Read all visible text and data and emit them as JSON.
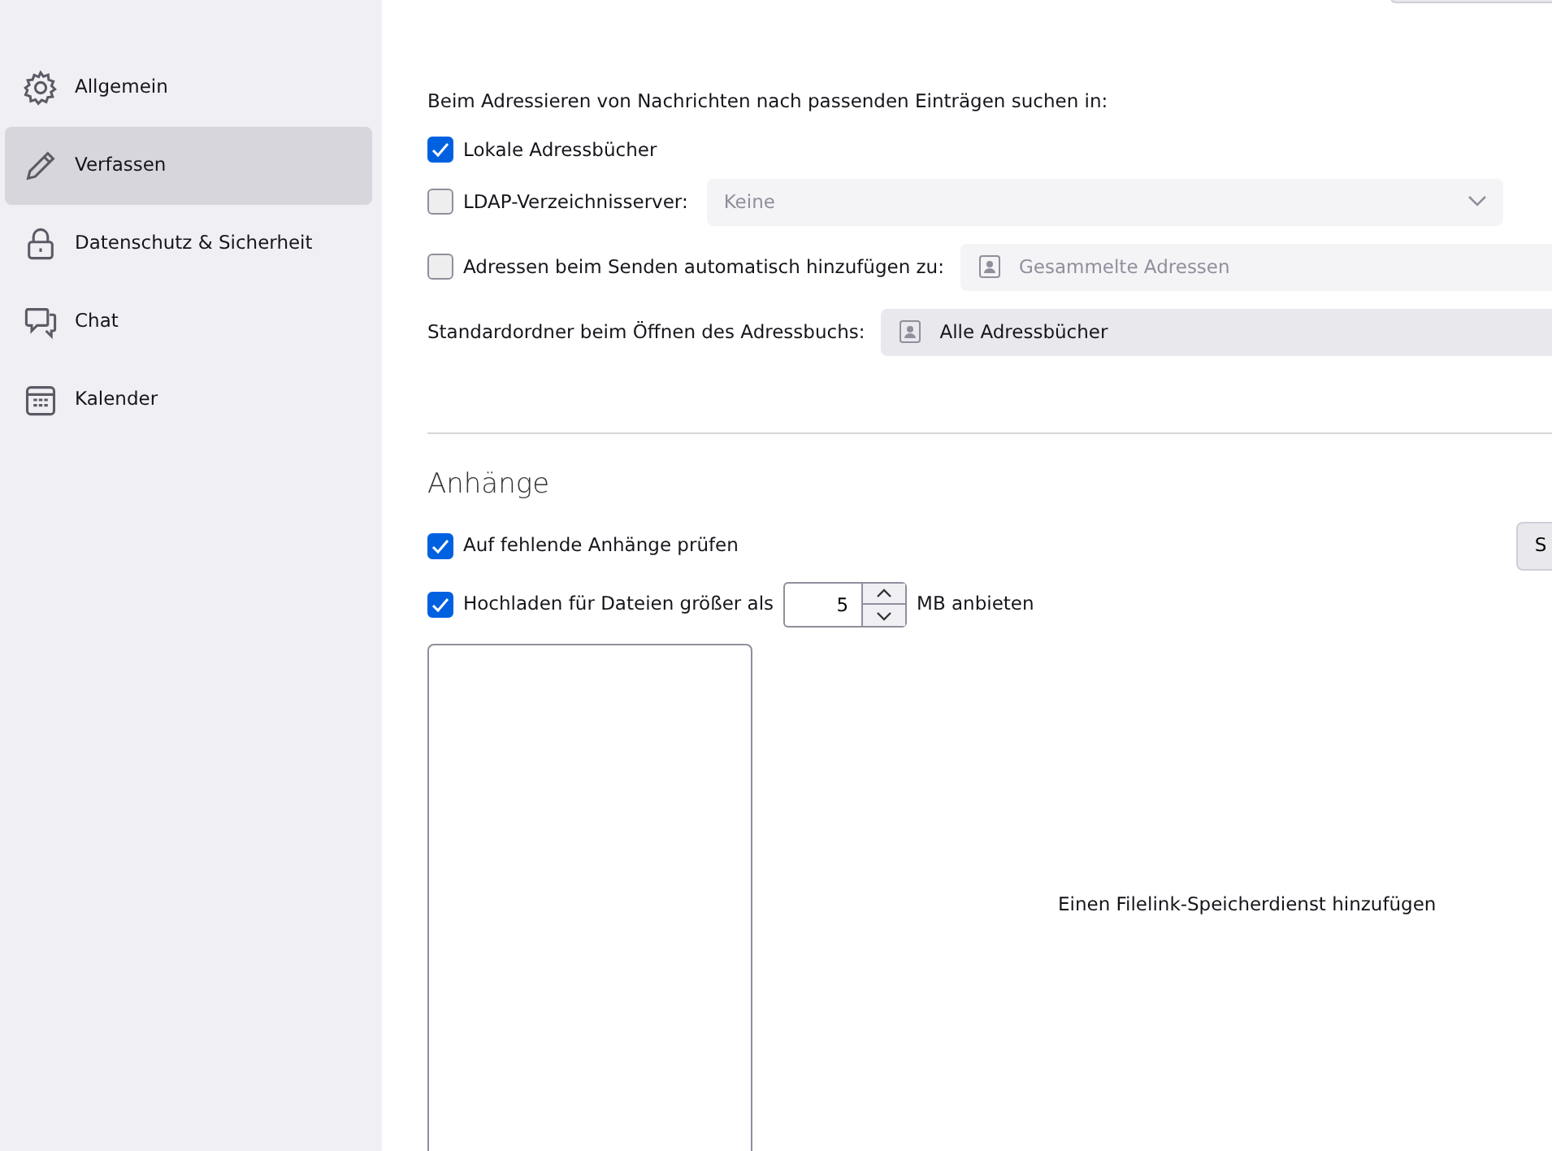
{
  "sidebar": {
    "items": [
      {
        "label": "Allgemein",
        "selected": false
      },
      {
        "label": "Verfassen",
        "selected": true
      },
      {
        "label": "Datenschutz & Sicherheit",
        "selected": false
      },
      {
        "label": "Chat",
        "selected": false
      },
      {
        "label": "Kalender",
        "selected": false
      }
    ]
  },
  "addressing": {
    "intro": "Beim Adressieren von Nachrichten nach passenden Einträgen suchen in:",
    "rows": [
      {
        "kind": "checkbox",
        "label": "Lokale Adressbücher",
        "checked": true
      },
      {
        "kind": "checkbox-select",
        "label": "LDAP-Verzeichnisserver:",
        "checked": false,
        "value": "Keine",
        "disabled": true
      },
      {
        "kind": "checkbox-book",
        "label": "Adressen beim Senden automatisch hinzufügen zu:",
        "checked": false,
        "value": "Gesammelte Adressen",
        "disabled": true
      },
      {
        "kind": "book",
        "label": "Standardordner beim Öffnen des Adressbuchs:",
        "value": "Alle Adressbücher",
        "disabled": false
      }
    ]
  },
  "attachments": {
    "heading": "Anhänge",
    "check_missing": {
      "label": "Auf fehlende Anhänge prüfen",
      "checked": true,
      "button": "S"
    },
    "upload": {
      "label": "Hochladen für Dateien größer als",
      "checked": true,
      "value": "5",
      "unit": "MB anbieten"
    },
    "filelink_hint": "Einen Filelink-Speicherdienst hinzufügen"
  }
}
